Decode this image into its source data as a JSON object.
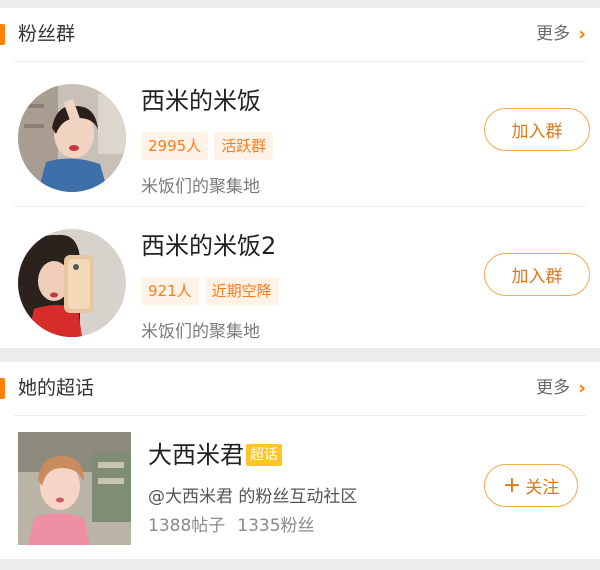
{
  "fan_groups": {
    "title": "粉丝群",
    "more": "更多",
    "items": [
      {
        "name": "西米的米饭",
        "members": "2995人",
        "status": "活跃群",
        "desc": "米饭们的聚集地",
        "join_label": "加入群"
      },
      {
        "name": "西米的米饭2",
        "members": "921人",
        "status": "近期空降",
        "desc": "米饭们的聚集地",
        "join_label": "加入群"
      }
    ]
  },
  "super_topic": {
    "title": "她的超话",
    "more": "更多",
    "name": "大西米君",
    "badge": "超话",
    "desc": "@大西米君 的粉丝互动社区",
    "posts": "1388帖子",
    "fans": "1335粉丝",
    "follow_label": "关注"
  },
  "colors": {
    "accent": "#ff8200",
    "tag_bg": "#fff2e6",
    "tag_text": "#ff7b1a",
    "badge_bg": "#ffc32b"
  }
}
